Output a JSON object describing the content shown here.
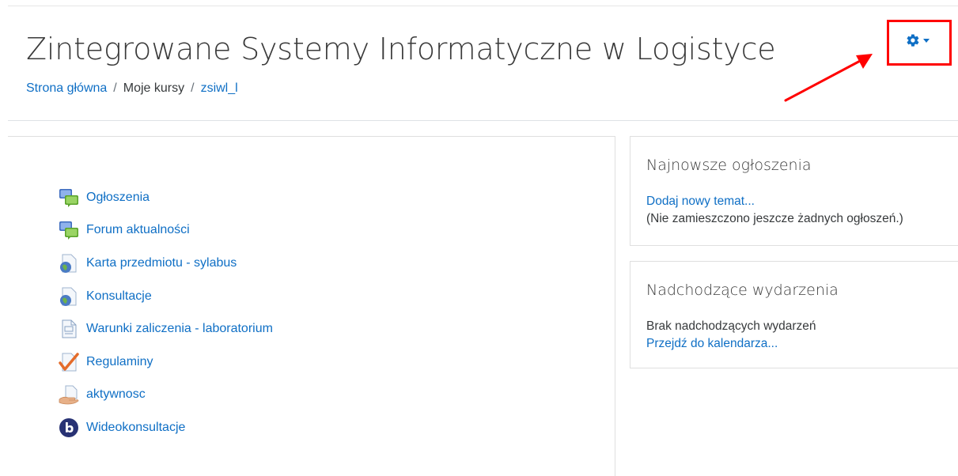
{
  "header": {
    "title": "Zintegrowane Systemy Informatyczne w Logistyce",
    "breadcrumb": [
      "Strona główna",
      "Moje kursy",
      "zsiwl_l"
    ],
    "separator": "/"
  },
  "settings_menu": {
    "icon": "gear-icon"
  },
  "activities": [
    {
      "label": "Ogłoszenia",
      "icon": "forum-icon"
    },
    {
      "label": "Forum aktualności",
      "icon": "forum-icon"
    },
    {
      "label": "Karta przedmiotu - sylabus",
      "icon": "url-globe-icon"
    },
    {
      "label": "Konsultacje",
      "icon": "url-globe-icon"
    },
    {
      "label": "Warunki zaliczenia - laboratorium",
      "icon": "page-icon"
    },
    {
      "label": "Regulaminy",
      "icon": "checkmark-icon"
    },
    {
      "label": "aktywnosc",
      "icon": "assignment-hand-icon"
    },
    {
      "label": "Wideokonsultacje",
      "icon": "bigbluebutton-icon"
    }
  ],
  "blocks": {
    "news": {
      "title": "Najnowsze ogłoszenia",
      "add_link": "Dodaj nowy temat...",
      "empty_text": "(Nie zamieszczono jeszcze żadnych ogłoszeń.)"
    },
    "events": {
      "title": "Nadchodzące wydarzenia",
      "empty_text": "Brak nadchodzących wydarzeń",
      "calendar_link": "Przejdź do kalendarza..."
    }
  },
  "colors": {
    "link": "#0f6fc5",
    "annotation": "#ff0000"
  }
}
